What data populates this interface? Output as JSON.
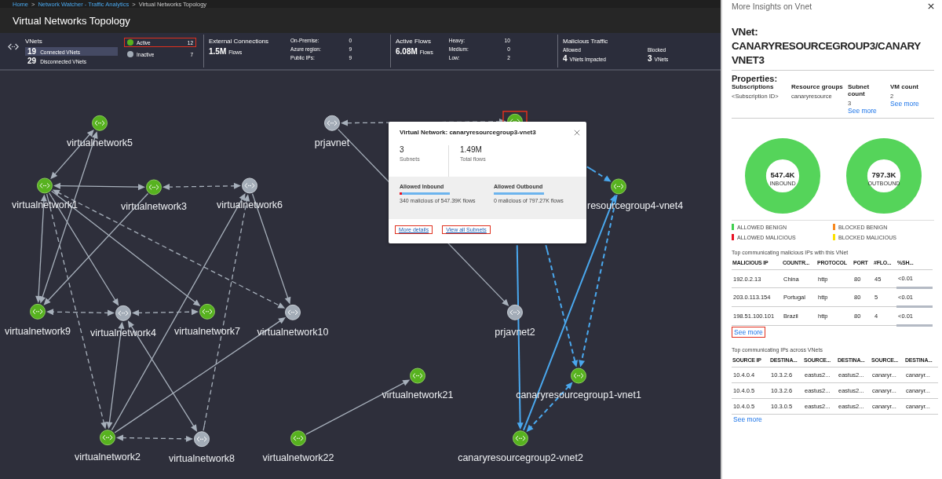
{
  "breadcrumb": {
    "separator": ">",
    "items": [
      {
        "label": "Home",
        "link": true
      },
      {
        "label": "Network Watcher - Traffic Analytics",
        "link": true
      },
      {
        "label": "Virtual Networks Topology",
        "link": false
      }
    ]
  },
  "page_title": "Virtual Networks Topology",
  "summary": {
    "vnets": {
      "title": "VNets",
      "rows": [
        {
          "count": "19",
          "label": "Connected VNets",
          "selected": true
        },
        {
          "count": "29",
          "label": "Disconnected VNets",
          "selected": false
        }
      ],
      "states": [
        {
          "label": "Active",
          "count": "12",
          "active": true,
          "annotated": true
        },
        {
          "label": "Inactive",
          "count": "7",
          "active": false,
          "annotated": false
        }
      ]
    },
    "external": {
      "title": "External Connections",
      "value": "1.5M",
      "unit": "Flows",
      "stats": [
        {
          "label": "On-Premise:",
          "value": "0"
        },
        {
          "label": "Azure region:",
          "value": "9"
        },
        {
          "label": "Public IPs:",
          "value": "9"
        }
      ]
    },
    "flows": {
      "title": "Active Flows",
      "value": "6.08M",
      "unit": "Flows",
      "stats": [
        {
          "label": "Heavy:",
          "value": "10"
        },
        {
          "label": "Medium:",
          "value": "0"
        },
        {
          "label": "Low:",
          "value": "2"
        }
      ]
    },
    "malicious": {
      "title": "Malicious Traffic",
      "groups": [
        {
          "label": "Allowed",
          "value": "4",
          "unit": "VNets Impacted"
        },
        {
          "label": "Blocked",
          "value": "3",
          "unit": "VNets"
        }
      ]
    }
  },
  "topology": {
    "nodes": [
      {
        "label": "virtualnetwork5",
        "active": true
      },
      {
        "label": "virtualnetwork1",
        "active": true
      },
      {
        "label": "virtualnetwork3",
        "active": true
      },
      {
        "label": "virtualnetwork6",
        "active": false
      },
      {
        "label": "prjavnet",
        "active": false
      },
      {
        "active": true,
        "annotated": true
      },
      {
        "label": "resourcegroup4-vnet4",
        "active": true
      },
      {
        "label": "virtualnetwork9",
        "active": true
      },
      {
        "label": "virtualnetwork4",
        "active": false
      },
      {
        "label": "virtualnetwork7",
        "active": true
      },
      {
        "label": "virtualnetwork10",
        "active": false
      },
      {
        "label": "prjavnet2",
        "active": false
      },
      {
        "label": "virtualnetwork21",
        "active": true
      },
      {
        "label": "canaryresourcegroup1-vnet1",
        "active": true
      },
      {
        "label": "virtualnetwork2",
        "active": true
      },
      {
        "label": "virtualnetwork8",
        "active": false
      },
      {
        "label": "virtualnetwork22",
        "active": true
      },
      {
        "label": "canaryresourcegroup2-vnet2",
        "active": true
      }
    ],
    "edges": [
      {
        "dashed": false,
        "bidirectional": true,
        "highlighted": false
      },
      {
        "dashed": false,
        "bidirectional": true,
        "highlighted": false
      },
      {
        "dashed": false,
        "bidirectional": true,
        "highlighted": false
      },
      {
        "dashed": true,
        "bidirectional": true,
        "highlighted": false
      },
      {
        "dashed": false,
        "bidirectional": true,
        "highlighted": false
      },
      {
        "dashed": false,
        "bidirectional": false,
        "highlighted": false
      },
      {
        "dashed": false,
        "bidirectional": false,
        "highlighted": false
      },
      {
        "dashed": false,
        "bidirectional": false,
        "highlighted": false
      },
      {
        "dashed": true,
        "bidirectional": true,
        "highlighted": false
      },
      {
        "dashed": true,
        "bidirectional": false,
        "highlighted": false
      },
      {
        "dashed": false,
        "bidirectional": false,
        "highlighted": false
      },
      {
        "dashed": false,
        "bidirectional": false,
        "highlighted": false
      },
      {
        "dashed": true,
        "bidirectional": false,
        "highlighted": false
      },
      {
        "dashed": true,
        "bidirectional": true,
        "highlighted": false
      },
      {
        "dashed": true,
        "bidirectional": true,
        "highlighted": false
      },
      {
        "dashed": false,
        "bidirectional": true,
        "highlighted": false
      },
      {
        "dashed": false,
        "bidirectional": true,
        "highlighted": false
      },
      {
        "dashed": true,
        "bidirectional": true,
        "highlighted": false
      },
      {
        "dashed": false,
        "bidirectional": false,
        "highlighted": false
      },
      {
        "dashed": false,
        "bidirectional": false,
        "highlighted": false
      },
      {
        "dashed": true,
        "bidirectional": true,
        "highlighted": false
      },
      {
        "dashed": false,
        "bidirectional": false,
        "highlighted": false
      },
      {
        "dashed": true,
        "bidirectional": false,
        "highlighted": true
      },
      {
        "dashed": false,
        "bidirectional": false,
        "highlighted": true
      },
      {
        "dashed": true,
        "bidirectional": false,
        "highlighted": true
      },
      {
        "dashed": false,
        "bidirectional": false,
        "highlighted": true
      },
      {
        "dashed": true,
        "bidirectional": false,
        "highlighted": true
      },
      {
        "dashed": true,
        "bidirectional": true,
        "highlighted": true
      }
    ]
  },
  "popup": {
    "title": "Virtual Network: canaryresourcegroup3-vnet3",
    "stats": [
      {
        "value": "3",
        "label": "Subnets"
      },
      {
        "value": "1.49M",
        "label": "Total flows"
      }
    ],
    "flows": [
      {
        "title": "Allowed Inbound",
        "level": 0.05,
        "caption": "340 malicious of 547.39K flows"
      },
      {
        "title": "Allowed Outbound",
        "level": 0,
        "caption": "0 malicious of 797.27K flows"
      }
    ],
    "links": [
      {
        "label": "More details",
        "annotated": true
      },
      {
        "label": "View all Subnets",
        "annotated": true
      }
    ]
  },
  "insights": {
    "title": "More Insights on Vnet",
    "heading": [
      "VNet:",
      "CANARYRESOURCEGROUP3/CANARY",
      "VNET3"
    ],
    "properties_label": "Properties:",
    "properties": [
      {
        "name": "Subscriptions",
        "value": "<Subscription ID>"
      },
      {
        "name": "Resource groups",
        "value": "canaryresource"
      },
      {
        "name": "Subnet count",
        "value": "3",
        "link": "See more"
      },
      {
        "name": "VM count",
        "value": "2",
        "link": "See more"
      }
    ],
    "donuts": [
      {
        "value": "547.4K",
        "label": "INBOUND"
      },
      {
        "value": "797.3K",
        "label": "OUTBOUND"
      }
    ],
    "legend": [
      {
        "label": "ALLOWED BENIGN",
        "color": "#3fcf4f"
      },
      {
        "label": "BLOCKED BENIGN",
        "color": "#f7891f"
      },
      {
        "label": "ALLOWED MALICIOUS",
        "color": "#e81123"
      },
      {
        "label": "BLOCKED MALICIOUS",
        "color": "#fce100"
      }
    ],
    "tables": [
      {
        "title": "Top communicating malicious IPs with this VNet",
        "columns": [
          "MALICIOUS IP",
          "COUNTR...",
          "PROTOCOL",
          "PORT",
          "#FLO...",
          "%SH..."
        ],
        "rows": [
          [
            "192.0.2.13",
            "China",
            "http",
            "80",
            "45",
            "<0.01"
          ],
          [
            "203.0.113.154",
            "Portugal",
            "http",
            "80",
            "5",
            "<0.01"
          ],
          [
            "198.51.100.101",
            "Brazil",
            "http",
            "80",
            "4",
            "<0.01"
          ]
        ],
        "link": {
          "label": "See more",
          "annotated": true
        }
      },
      {
        "title": "Top communicating IPs across VNets",
        "columns": [
          "SOURCE IP",
          "DESTINA...",
          "SOURCE...",
          "DESTINA...",
          "SOURCE...",
          "DESTINA..."
        ],
        "rows": [
          [
            "10.4.0.4",
            "10.3.2.6",
            "eastus2...",
            "eastus2...",
            "canaryr...",
            "canaryr..."
          ],
          [
            "10.4.0.5",
            "10.3.2.6",
            "eastus2...",
            "eastus2...",
            "canaryr...",
            "canaryr..."
          ],
          [
            "10.4.0.5",
            "10.3.0.5",
            "eastus2...",
            "eastus2...",
            "canaryr...",
            "canaryr..."
          ]
        ],
        "link": {
          "label": "See more",
          "annotated": false
        }
      }
    ]
  }
}
